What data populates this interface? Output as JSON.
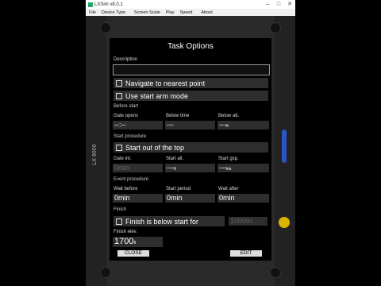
{
  "window": {
    "title": "LXSim v8.0.1"
  },
  "menu": [
    "File",
    "Device Type",
    "Screen Scale",
    "Play",
    "Speed",
    "About"
  ],
  "device": {
    "model_label": "LX 9000"
  },
  "screen": {
    "title": "Task Options",
    "description_label": "Description",
    "description_value": "",
    "navigate_nearest": "Navigate to nearest point",
    "start_arm_mode": "Use start arm mode",
    "before_start": {
      "section": "Before start",
      "gate_opens_label": "Gate opens",
      "gate_opens_value": "--:--",
      "below_time_label": "Below time",
      "below_time_value": "---",
      "below_alt_label": "Below alt.",
      "below_alt_value": "---",
      "below_alt_unit": "ft"
    },
    "start_procedure": {
      "section": "Start procedure",
      "start_out_top": "Start out of the top",
      "gate_int_label": "Gate int.",
      "gate_int_value": "0min",
      "start_alt_label": "Start alt.",
      "start_alt_value": "---",
      "start_alt_unit": "ft",
      "start_gsp_label": "Start gsp.",
      "start_gsp_value": "---",
      "start_gsp_unit": "kts"
    },
    "event_procedure": {
      "section": "Event procedure",
      "wait_before_label": "Wait before",
      "wait_before_value": "0min",
      "start_period_label": "Start period",
      "start_period_value": "0min",
      "wait_after_label": "Wait after",
      "wait_after_value": "0min"
    },
    "finish": {
      "section": "Finish",
      "finish_below_start": "Finish is below start for",
      "finish_below_value": "1000m",
      "finish_elev_label": "Finish elev.",
      "finish_elev_value": "1700",
      "finish_elev_unit": "ft"
    },
    "close_button": "CLOSE",
    "edit_button": "EDIT"
  }
}
